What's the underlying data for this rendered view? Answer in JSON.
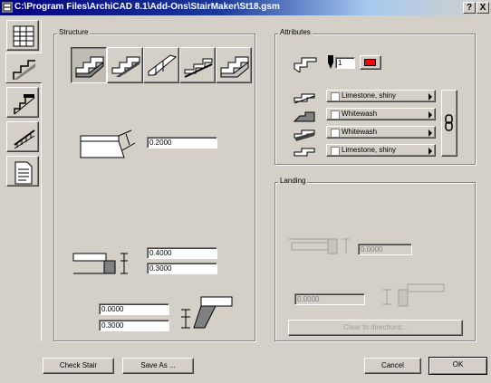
{
  "window": {
    "title": "C:\\Program Files\\ArchiCAD 8.1\\Add-Ons\\StairMaker\\St18.gsm",
    "help_glyph": "?",
    "close_glyph": "X"
  },
  "tabs": [
    {
      "name": "tab-settings",
      "icon": "table-icon"
    },
    {
      "name": "tab-structure",
      "icon": "stair-profile-icon",
      "selected": true
    },
    {
      "name": "tab-landing",
      "icon": "landing-icon"
    },
    {
      "name": "tab-railing",
      "icon": "railing-icon"
    },
    {
      "name": "tab-listing",
      "icon": "document-icon"
    }
  ],
  "structure": {
    "label": "Structure",
    "stair_types": [
      "stair-type-1-icon",
      "stair-type-2-icon",
      "stair-type-3-icon",
      "stair-type-4-icon",
      "stair-type-5-icon"
    ],
    "nosing_value": "0.2000",
    "riser_a": "0.4000",
    "riser_b": "0.3000",
    "stringer_a": "0.0000",
    "stringer_b": "0.3000"
  },
  "attributes": {
    "label": "Attributes",
    "pen_value": "1",
    "pen_color": "#ff0000",
    "materials": [
      "Limestone, shiny",
      "Whitewash",
      "Whitewash",
      "Limestone, shiny"
    ]
  },
  "landing": {
    "label": "Landing",
    "value_a": "0.0000",
    "value_b": "0.0000",
    "clear_button": "Clear to directions..."
  },
  "footer": {
    "check_stair": "Check Stair",
    "save_as": "Save As ...",
    "cancel": "Cancel",
    "ok": "OK"
  }
}
